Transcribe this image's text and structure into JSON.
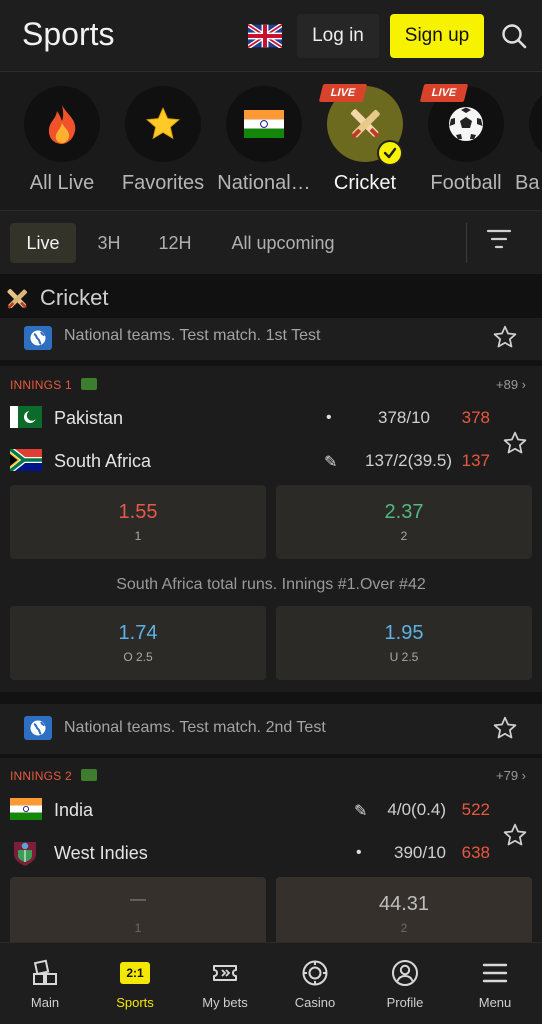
{
  "header": {
    "title": "Sports",
    "language_icon": "uk-flag-icon",
    "login_label": "Log in",
    "signup_label": "Sign up",
    "search_icon": "search-icon"
  },
  "sports_nav": {
    "items": [
      {
        "label": "All Live",
        "icon": "fire-icon",
        "active": false,
        "live": false
      },
      {
        "label": "Favorites",
        "icon": "star-icon",
        "active": false,
        "live": false
      },
      {
        "label": "National…",
        "icon": "india-flag-icon",
        "active": false,
        "live": false
      },
      {
        "label": "Cricket",
        "icon": "cricket-icon",
        "active": true,
        "live": true,
        "live_label": "LIVE"
      },
      {
        "label": "Football",
        "icon": "football-icon",
        "active": false,
        "live": true,
        "live_label": "LIVE"
      },
      {
        "label": "Ba",
        "icon": "basketball-icon",
        "active": false,
        "live": false
      }
    ]
  },
  "filters": {
    "tabs": [
      "Live",
      "3H",
      "12H",
      "All upcoming"
    ],
    "active": "Live"
  },
  "section": {
    "title": "Cricket"
  },
  "leagues": [
    {
      "name": "National teams. Test match. 1st Test",
      "match": {
        "innings": "INNINGS 1",
        "more": "+89 ›",
        "teams": [
          {
            "name": "Pakistan",
            "mark": "•",
            "score": "378/10",
            "total": "378"
          },
          {
            "name": "South Africa",
            "mark": "✎",
            "score": "137/2(39.5)",
            "total": "137"
          }
        ],
        "main_odds": [
          {
            "value": "1.55",
            "label": "1",
            "trend": "down"
          },
          {
            "value": "2.37",
            "label": "2",
            "trend": "up"
          }
        ],
        "market": {
          "title": "South Africa total runs. Innings #1.Over #42",
          "odds": [
            {
              "value": "1.74",
              "label": "O 2.5"
            },
            {
              "value": "1.95",
              "label": "U 2.5"
            }
          ]
        }
      }
    },
    {
      "name": "National teams. Test match. 2nd Test",
      "match": {
        "innings": "INNINGS 2",
        "more": "+79 ›",
        "teams": [
          {
            "name": "India",
            "mark": "✎",
            "score": "4/0(0.4)",
            "total": "522"
          },
          {
            "name": "West Indies",
            "mark": "•",
            "score": "390/10",
            "total": "638"
          }
        ],
        "main_odds": [
          {
            "value": "—",
            "label": "1"
          },
          {
            "value": "44.31",
            "label": "2"
          }
        ]
      }
    }
  ],
  "bottom_nav": [
    {
      "label": "Main",
      "icon": "main-icon",
      "active": false
    },
    {
      "label": "Sports",
      "icon": "sports-icon",
      "badge": "2:1",
      "active": true
    },
    {
      "label": "My bets",
      "icon": "ticket-icon",
      "active": false
    },
    {
      "label": "Casino",
      "icon": "casino-chip-icon",
      "active": false
    },
    {
      "label": "Profile",
      "icon": "profile-icon",
      "active": false
    },
    {
      "label": "Menu",
      "icon": "menu-icon",
      "active": false
    }
  ],
  "colors": {
    "accent": "#f7f200",
    "live_red": "#d9432c",
    "odds_down": "#e6594a",
    "odds_up": "#52b781",
    "market_blue": "#5bb1e8"
  }
}
